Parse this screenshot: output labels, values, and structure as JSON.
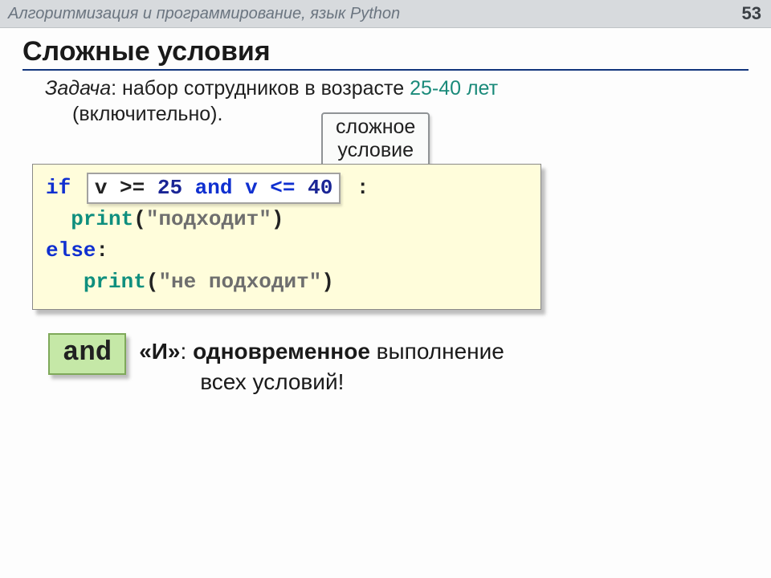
{
  "header": {
    "breadcrumb": "Алгоритмизация и программирование, язык Python",
    "page_number": "53"
  },
  "title": "Сложные условия",
  "task": {
    "label": "Задача",
    "text_before": ": набор сотрудников в возрасте ",
    "range": "25-40 лет",
    "inclusive": "(включительно).",
    "callout_line1": "сложное",
    "callout_line2": "условие"
  },
  "code": {
    "kw_if": "if",
    "cond_prefix": "v >= ",
    "cond_num1": "25",
    "cond_mid": " and v <= ",
    "cond_num2": "40",
    "colon": ":",
    "fn_print": "print",
    "str_ok": "\"подходит\"",
    "kw_else": "else",
    "str_no": "\"не подходит\""
  },
  "and_block": {
    "box": "and",
    "quote": "«И»",
    "line1_bold": "одновременное",
    "line1_rest": " выполнение",
    "line2": "всех условий!"
  }
}
